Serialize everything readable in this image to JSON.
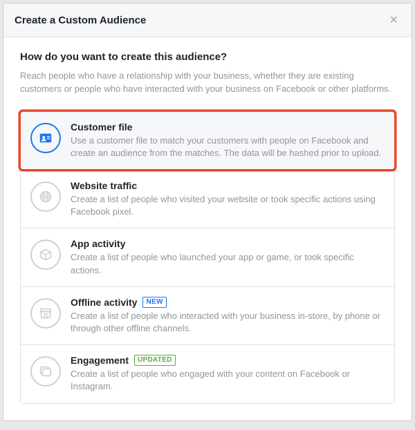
{
  "header": {
    "title": "Create a Custom Audience"
  },
  "body": {
    "question": "How do you want to create this audience?",
    "subtext": "Reach people who have a relationship with your business, whether they are existing customers or people who have interacted with your business on Facebook or other platforms."
  },
  "options": {
    "customer_file": {
      "title": "Customer file",
      "desc": "Use a customer file to match your customers with people on Facebook and create an audience from the matches. The data will be hashed prior to upload."
    },
    "website_traffic": {
      "title": "Website traffic",
      "desc": "Create a list of people who visited your website or took specific actions using Facebook pixel."
    },
    "app_activity": {
      "title": "App activity",
      "desc": "Create a list of people who launched your app or game, or took specific actions."
    },
    "offline_activity": {
      "title": "Offline activity",
      "badge": "NEW",
      "desc": "Create a list of people who interacted with your business in-store, by phone or through other offline channels."
    },
    "engagement": {
      "title": "Engagement",
      "badge": "UPDATED",
      "desc": "Create a list of people who engaged with your content on Facebook or Instagram."
    }
  }
}
